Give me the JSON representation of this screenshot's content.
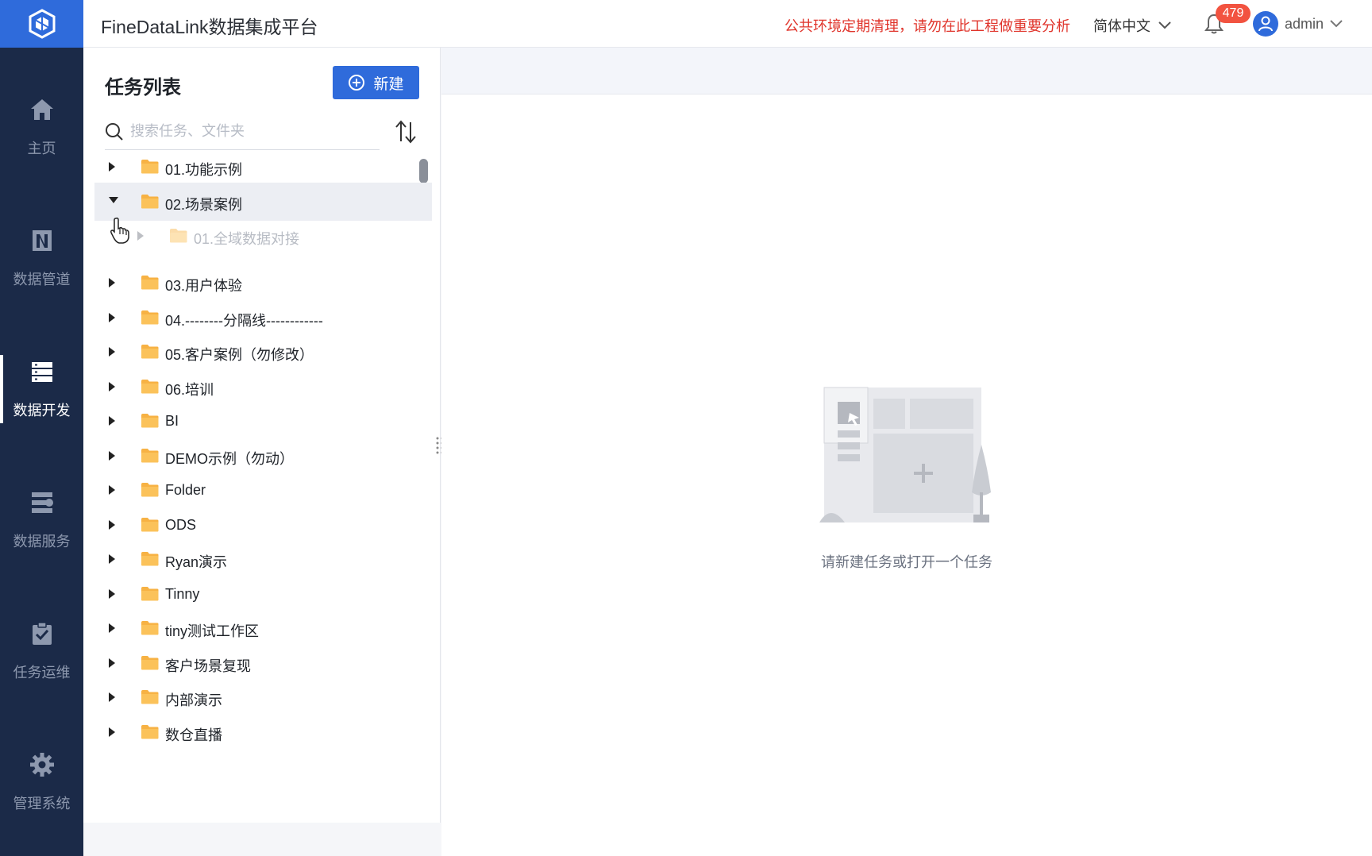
{
  "header": {
    "title": "FineDataLink数据集成平台",
    "notice": "公共环境定期清理，请勿在此工程做重要分析",
    "language": "简体中文",
    "notification_count": "479",
    "username": "admin"
  },
  "sidenav": {
    "items": [
      {
        "label": "主页",
        "icon": "home-icon"
      },
      {
        "label": "数据管道",
        "icon": "pipeline-icon"
      },
      {
        "label": "数据开发",
        "icon": "database-dev-icon",
        "active": true
      },
      {
        "label": "数据服务",
        "icon": "data-service-icon"
      },
      {
        "label": "任务运维",
        "icon": "task-ops-icon"
      },
      {
        "label": "管理系统",
        "icon": "gear-icon"
      }
    ]
  },
  "panel": {
    "title": "任务列表",
    "new_button": "新建",
    "search_placeholder": "搜索任务、文件夹",
    "tree": [
      {
        "label": "01.功能示例"
      },
      {
        "label": "02.场景案例",
        "expanded": true,
        "selected": true
      },
      {
        "label": "01.全域数据对接",
        "child": true
      },
      {
        "label": "03.用户体验"
      },
      {
        "label": "04.--------分隔线------------"
      },
      {
        "label": "05.客户案例（勿修改）"
      },
      {
        "label": "06.培训"
      },
      {
        "label": "BI"
      },
      {
        "label": "DEMO示例（勿动）"
      },
      {
        "label": "Folder"
      },
      {
        "label": "ODS"
      },
      {
        "label": "Ryan演示"
      },
      {
        "label": "Tinny"
      },
      {
        "label": "tiny测试工作区"
      },
      {
        "label": "客户场景复现"
      },
      {
        "label": "内部演示"
      },
      {
        "label": "数仓直播"
      }
    ]
  },
  "main": {
    "empty_text": "请新建任务或打开一个任务"
  },
  "colors": {
    "primary": "#2f6bdb",
    "sidenav_bg": "#1b2a48",
    "notice": "#e0342b",
    "folder": "#f7b244"
  }
}
